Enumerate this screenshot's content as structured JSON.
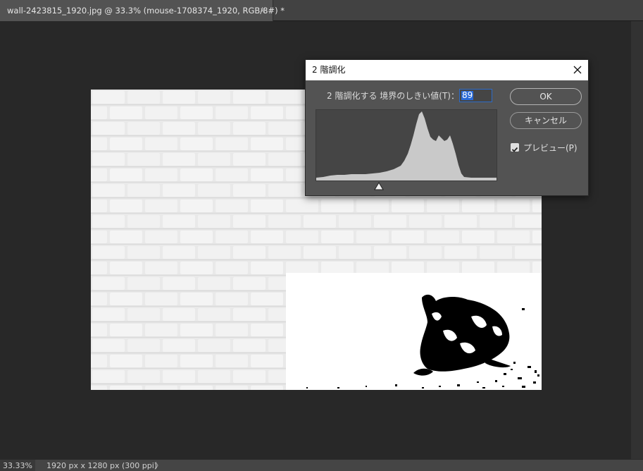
{
  "document_tab": {
    "title": "wall-2423815_1920.jpg @ 33.3% (mouse-1708374_1920, RGB/8#) *",
    "close_glyph": "×"
  },
  "status_bar": {
    "zoom": "33.33%",
    "doc_info": "1920 px x 1280 px (300 ppi)",
    "more_glyph": "〉"
  },
  "dialog": {
    "title": "2 階調化",
    "threshold_label": "2 階調化する 境界のしきい値(T)：",
    "threshold_value": "89",
    "ok_label": "OK",
    "cancel_label": "キャンセル",
    "preview_label": "プレビュー(P)",
    "preview_checked": true
  },
  "colors": {
    "workspace": "#282828",
    "dialog_bg": "#535353",
    "histogram_fill": "#c9c9c9",
    "selection": "#2a6ad6"
  }
}
